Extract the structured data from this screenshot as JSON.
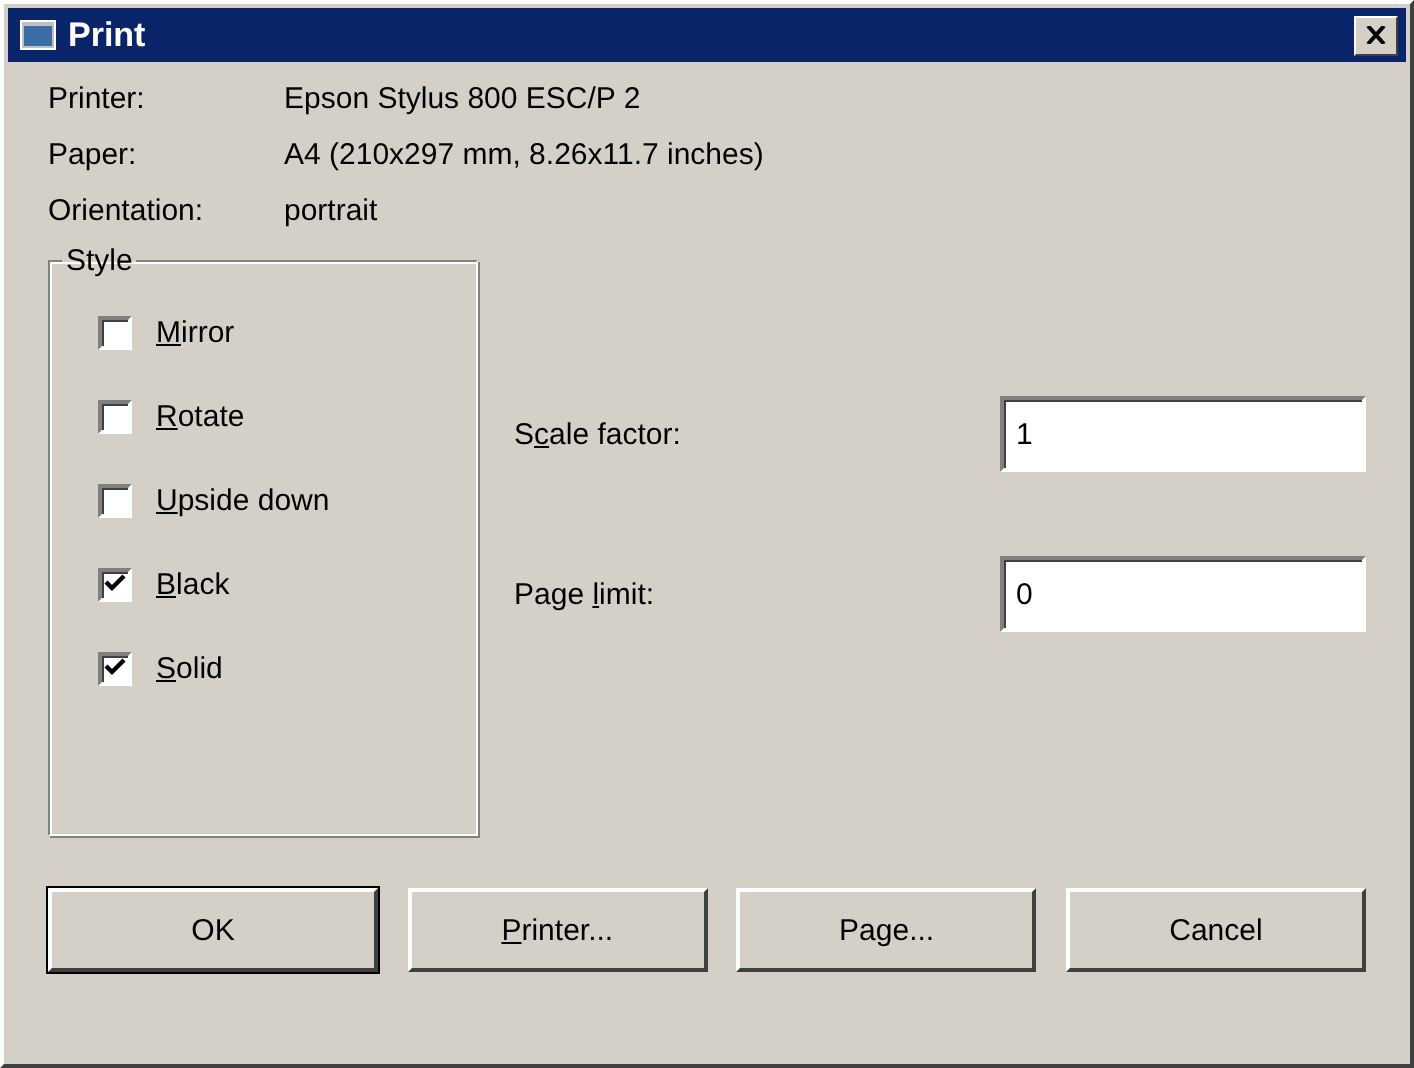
{
  "window": {
    "title": "Print"
  },
  "info": [
    {
      "label": "Printer:",
      "value": "Epson Stylus 800 ESC/P 2"
    },
    {
      "label": "Paper:",
      "value": "A4 (210x297 mm, 8.26x11.7 inches)"
    },
    {
      "label": "Orientation:",
      "value": "portrait"
    }
  ],
  "style_group": {
    "title": "Style",
    "options": [
      {
        "label": {
          "key": "M",
          "after": "irror"
        },
        "checked": false
      },
      {
        "label": {
          "key": "R",
          "after": "otate"
        },
        "checked": false
      },
      {
        "label": {
          "key": "U",
          "after": "pside down"
        },
        "checked": false
      },
      {
        "label": {
          "key": "B",
          "after": "lack"
        },
        "checked": true
      },
      {
        "label": {
          "key": "S",
          "after": "olid"
        },
        "checked": true
      }
    ]
  },
  "fields": [
    {
      "label": {
        "before": "S",
        "key": "c",
        "after": "ale factor:"
      },
      "value": "1"
    },
    {
      "label": {
        "before": "Page ",
        "key": "l",
        "after": "imit:"
      },
      "value": "0"
    }
  ],
  "buttons": [
    {
      "label": {
        "before": "OK"
      },
      "default": true
    },
    {
      "label": {
        "key": "P",
        "after": "rinter..."
      },
      "default": false
    },
    {
      "label": {
        "before": "Page..."
      },
      "default": false
    },
    {
      "label": {
        "before": "Cancel"
      },
      "default": false
    }
  ]
}
